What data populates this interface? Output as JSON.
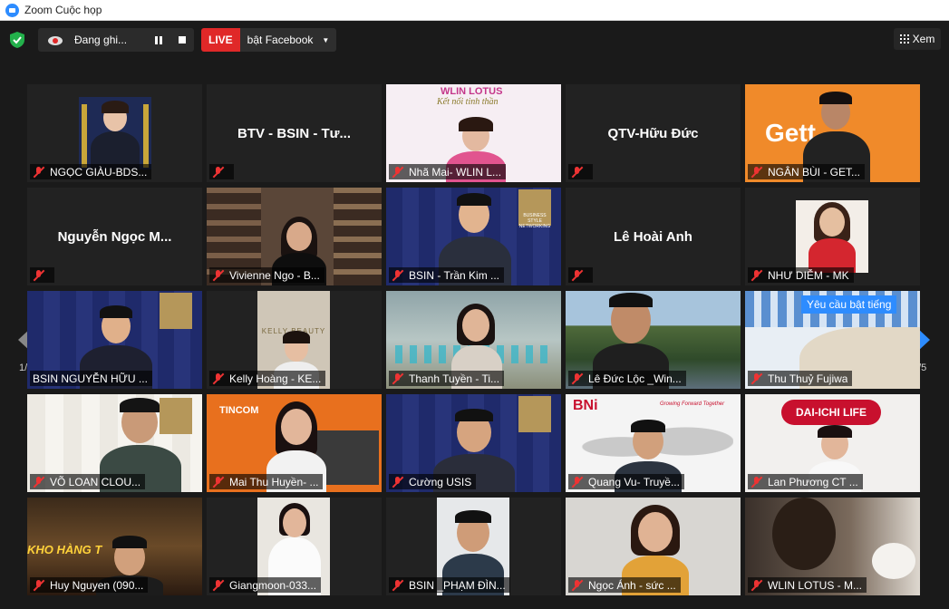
{
  "window": {
    "title": "Zoom Cuộc họp"
  },
  "toolbar": {
    "recording_label": "Đang ghi...",
    "live_badge": "LIVE",
    "live_destination": "bật Facebook",
    "view_label": "Xem"
  },
  "gallery": {
    "page_left": "1/5",
    "page_right": "1/5",
    "tooltip": "Yêu cầu bật tiếng",
    "tiles": [
      {
        "label": "NGỌC GIÀU-BDS...",
        "video": true
      },
      {
        "label": "",
        "display_name": "BTV - BSIN - Tư...",
        "video": false
      },
      {
        "label": "Nhã Mai- WLIN L...",
        "video": true
      },
      {
        "label": "",
        "display_name": "QTV-Hữu Đức",
        "video": false
      },
      {
        "label": "NGÂN BÙI - GET...",
        "video": true
      },
      {
        "label": "",
        "display_name": "Nguyễn Ngọc M...",
        "video": false
      },
      {
        "label": "Vivienne Ngo - B...",
        "video": true
      },
      {
        "label": "BSIN - Trần Kim ...",
        "video": true
      },
      {
        "label": "",
        "display_name": "Lê Hoài Anh",
        "video": false
      },
      {
        "label": "NHƯ DIỄM - MK",
        "video": true
      },
      {
        "label": "BSIN NGUYỄN HỮU ...",
        "video": true
      },
      {
        "label": "Kelly Hoàng - KE...",
        "video": true
      },
      {
        "label": "Thanh Tuyền - Ti...",
        "video": true
      },
      {
        "label": "Lê Đức Lộc _Win...",
        "video": true
      },
      {
        "label": "Thu Thuỷ Fujiwa",
        "video": true
      },
      {
        "label": "VÕ LOAN CLOU...",
        "video": true
      },
      {
        "label": "Mai Thu Huyền- ...",
        "video": true
      },
      {
        "label": "Cường USIS",
        "video": true
      },
      {
        "label": "Quang Vu- Truyề...",
        "video": true
      },
      {
        "label": "Lan Phương CT ...",
        "video": true
      },
      {
        "label": "Huy Nguyen (090...",
        "video": true
      },
      {
        "label": "Giangmoon-033...",
        "video": true
      },
      {
        "label": "BSIN _PHẠM ĐÌN...",
        "video": true
      },
      {
        "label": "Ngọc Ánh - sức ...",
        "video": true
      },
      {
        "label": "WLIN LOTUS - M...",
        "video": true
      }
    ]
  },
  "backdrops": {
    "wlin": "WLIN LOTUS",
    "wlin_sub": "Kết nối tinh thần",
    "gett": "Gett",
    "bni": "BNi",
    "bni_tag": "Growing Forward Together",
    "daiichi": "DAI-ICHI LIFE",
    "tincom": "TINCOM",
    "kelly": "KELLY BEAUTY",
    "kho": "KHO HÀNG T",
    "networking": "BUSINESS STYLE NETWORKING"
  },
  "colors": {
    "live": "#e02828",
    "active_speaker": "#e8d34a",
    "tooltip": "#2d8cff",
    "mic_off": "#e33333"
  }
}
